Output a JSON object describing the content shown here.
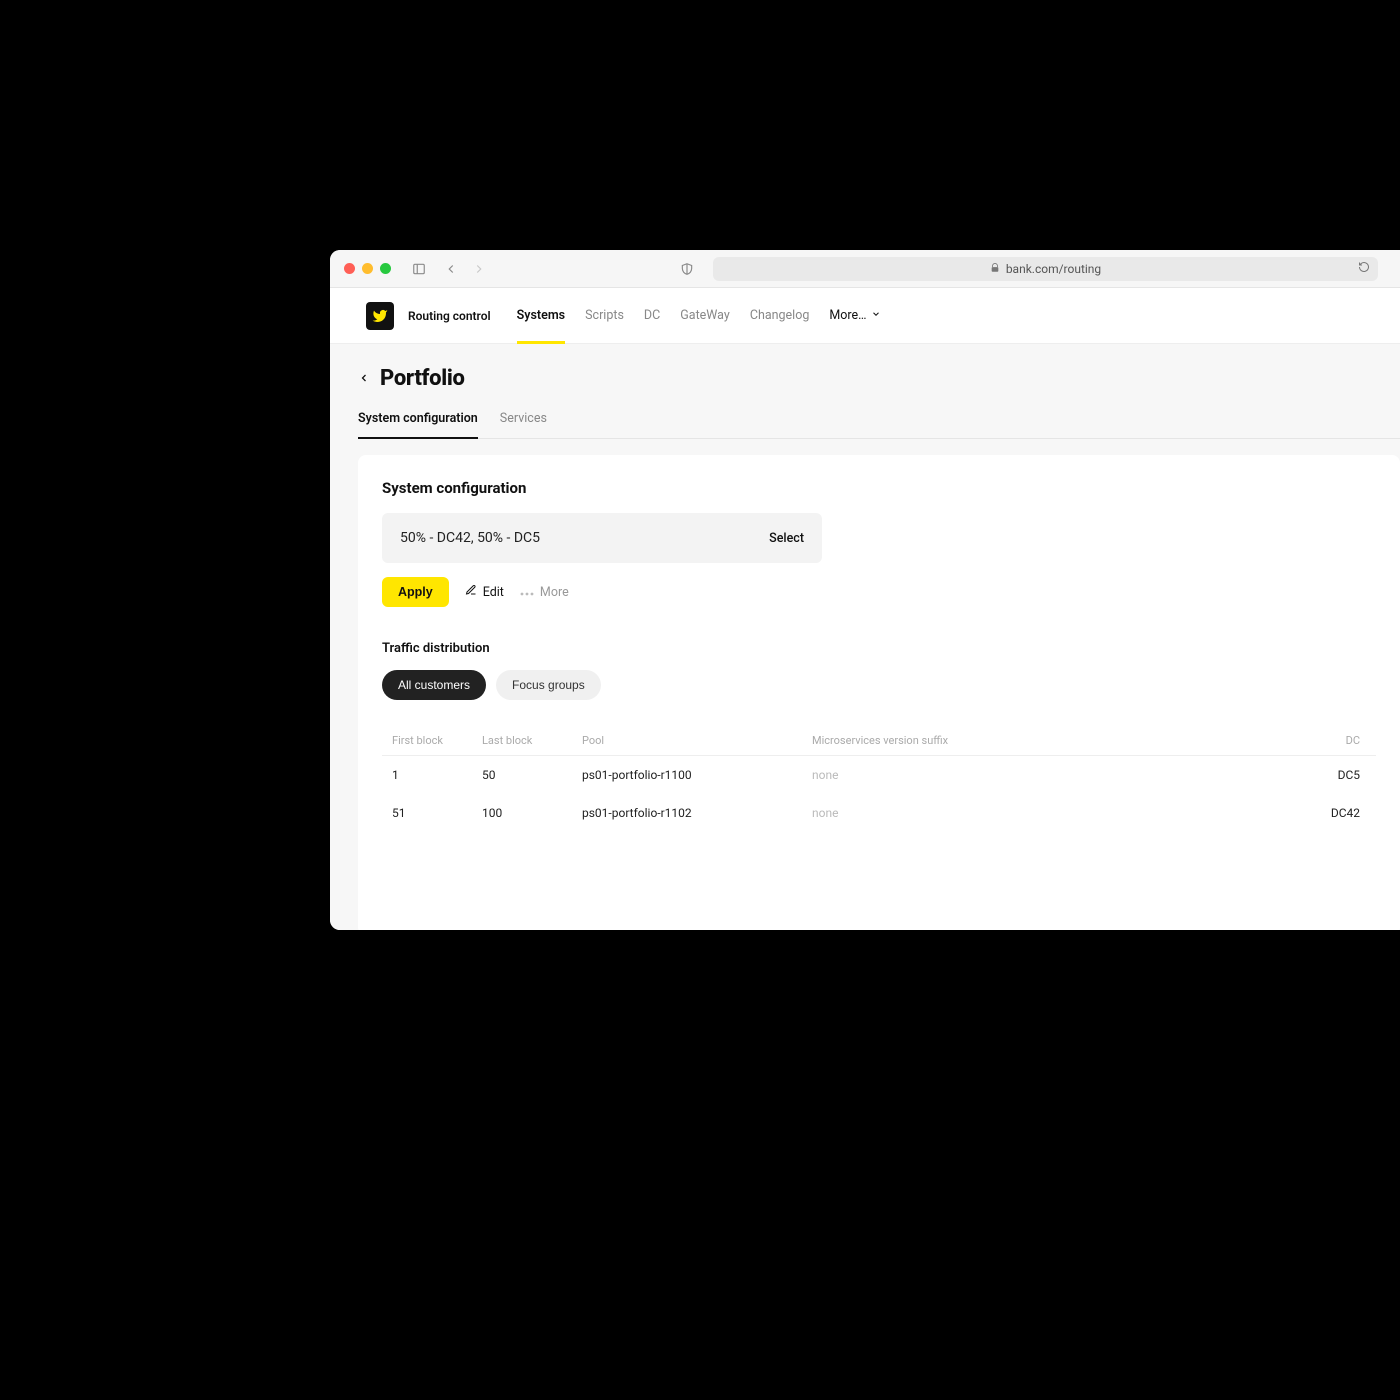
{
  "browser": {
    "url": "bank.com/routing"
  },
  "header": {
    "brand": "Routing control",
    "nav": {
      "systems": "Systems",
      "scripts": "Scripts",
      "dc": "DC",
      "gateway": "GateWay",
      "changelog": "Changelog",
      "more": "More…"
    }
  },
  "page": {
    "title": "Portfolio",
    "tabs": {
      "system_configuration": "System configuration",
      "services": "Services"
    }
  },
  "card": {
    "title": "System configuration",
    "selected_config": "50% - DC42, 50% - DC5",
    "select_label": "Select",
    "apply_label": "Apply",
    "edit_label": "Edit",
    "more_label": "More"
  },
  "traffic": {
    "section_label": "Traffic distribution",
    "pills": {
      "all_customers": "All customers",
      "focus_groups": "Focus groups"
    },
    "columns": {
      "first_block": "First block",
      "last_block": "Last block",
      "pool": "Pool",
      "suffix": "Microservices version suffix",
      "dc": "DC"
    },
    "rows": [
      {
        "first": "1",
        "last": "50",
        "pool": "ps01-portfolio-r1100",
        "suffix": "none",
        "dc": "DC5"
      },
      {
        "first": "51",
        "last": "100",
        "pool": "ps01-portfolio-r1102",
        "suffix": "none",
        "dc": "DC42"
      }
    ]
  }
}
